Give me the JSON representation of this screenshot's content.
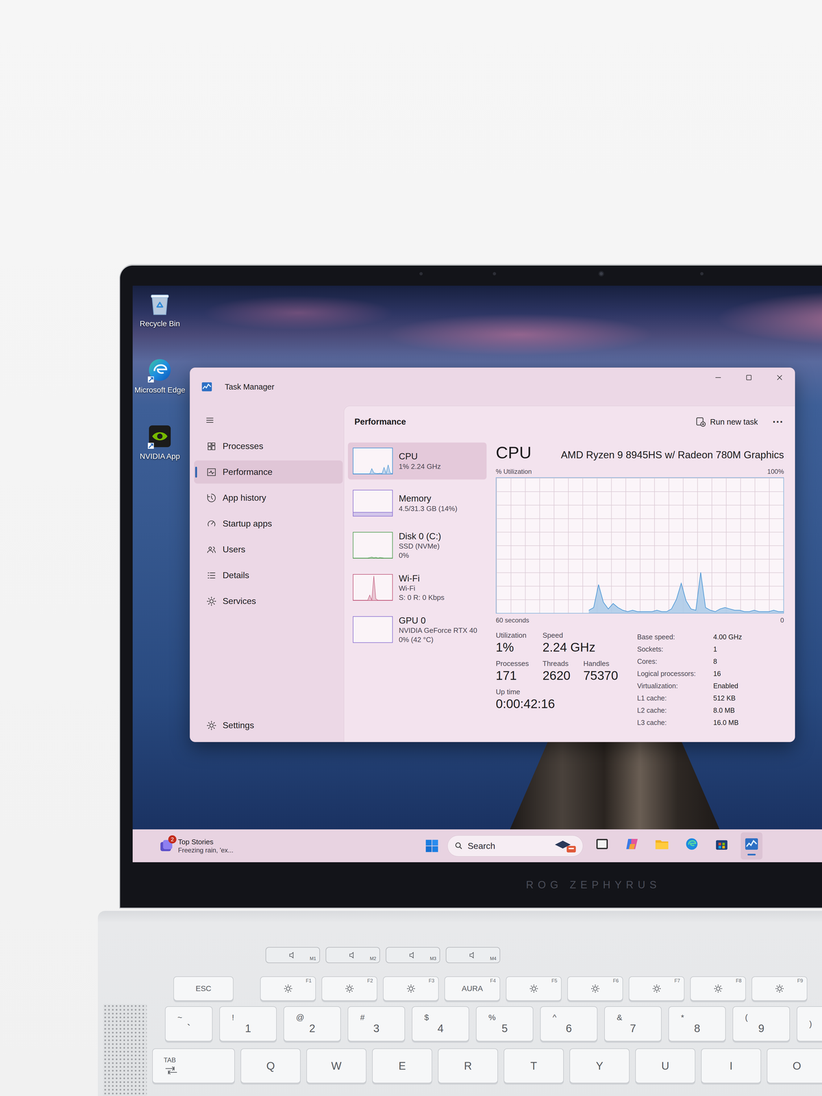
{
  "desktop_icons": [
    {
      "label": "Recycle Bin"
    },
    {
      "label": "Microsoft Edge"
    },
    {
      "label": "NVIDIA App"
    }
  ],
  "window": {
    "title": "Task Manager"
  },
  "sidebar": {
    "items": [
      {
        "label": "Processes",
        "selected": false
      },
      {
        "label": "Performance",
        "selected": true
      },
      {
        "label": "App history",
        "selected": false
      },
      {
        "label": "Startup apps",
        "selected": false
      },
      {
        "label": "Users",
        "selected": false
      },
      {
        "label": "Details",
        "selected": false
      },
      {
        "label": "Services",
        "selected": false
      }
    ],
    "settings": "Settings"
  },
  "header": {
    "title": "Performance",
    "action": "Run new task",
    "more": "···"
  },
  "resources": [
    {
      "name": "CPU",
      "lines": [
        "1% 2.24 GHz"
      ],
      "selected": true,
      "color": "#3f8fd2",
      "kind": "line",
      "values": [
        0,
        0,
        0,
        0,
        0,
        0,
        0,
        0,
        0,
        20,
        4,
        2,
        1,
        2,
        1,
        25,
        2,
        35,
        3,
        1
      ]
    },
    {
      "name": "Memory",
      "lines": [
        "4.5/31.3 GB (14%)"
      ],
      "selected": false,
      "color": "#8a6fd0",
      "kind": "fill",
      "level": 0.14
    },
    {
      "name": "Disk 0 (C:)",
      "lines": [
        "SSD (NVMe)",
        "0%"
      ],
      "selected": false,
      "color": "#4d9a4d",
      "kind": "line",
      "values": [
        0,
        0,
        0,
        0,
        0,
        0,
        0,
        0,
        2,
        4,
        1,
        3,
        0,
        2,
        1,
        0,
        0,
        0,
        0,
        0
      ]
    },
    {
      "name": "Wi-Fi",
      "lines": [
        "Wi-Fi",
        "S: 0 R: 0 Kbps"
      ],
      "selected": false,
      "color": "#c0587a",
      "kind": "line",
      "values": [
        0,
        0,
        0,
        0,
        0,
        0,
        0,
        0,
        20,
        0,
        95,
        5,
        0,
        0,
        0,
        0,
        0,
        0,
        0,
        0
      ]
    },
    {
      "name": "GPU 0",
      "lines": [
        "NVIDIA GeForce RTX 40",
        "0% (42 °C)"
      ],
      "selected": false,
      "color": "#8a6fd0",
      "kind": "line",
      "values": []
    }
  ],
  "chart": {
    "title": "CPU",
    "model": "AMD Ryzen 9 8945HS w/ Radeon 780M Graphics",
    "y_label": "% Utilization",
    "y_max": "100%",
    "x_left": "60 seconds",
    "x_right": "0",
    "y_max_value": 100,
    "window_seconds": 60,
    "values": [
      2,
      4,
      21,
      8,
      3,
      7,
      4,
      2,
      1,
      2,
      1,
      1,
      1,
      1,
      2,
      1,
      1,
      3,
      10,
      22,
      9,
      3,
      2,
      30,
      4,
      2,
      1,
      3,
      4,
      3,
      2,
      2,
      1,
      1,
      2,
      1,
      1,
      1,
      2,
      1,
      1
    ]
  },
  "stat_rows": [
    [
      {
        "label": "Utilization",
        "value": "1%"
      },
      {
        "label": "Speed",
        "value": "2.24 GHz"
      }
    ],
    [
      {
        "label": "Processes",
        "value": "171"
      },
      {
        "label": "Threads",
        "value": "2620"
      },
      {
        "label": "Handles",
        "value": "75370"
      }
    ],
    [
      {
        "label": "Up time",
        "value": "0:00:42:16"
      }
    ]
  ],
  "specs": [
    {
      "label": "Base speed:",
      "value": "4.00 GHz"
    },
    {
      "label": "Sockets:",
      "value": "1"
    },
    {
      "label": "Cores:",
      "value": "8"
    },
    {
      "label": "Logical processors:",
      "value": "16"
    },
    {
      "label": "Virtualization:",
      "value": "Enabled"
    },
    {
      "label": "L1 cache:",
      "value": "512 KB"
    },
    {
      "label": "L2 cache:",
      "value": "8.0 MB"
    },
    {
      "label": "L3 cache:",
      "value": "16.0 MB"
    }
  ],
  "taskbar": {
    "news": {
      "badge": "2",
      "title": "Top Stories",
      "text": "Freezing rain, 'ex..."
    },
    "search": "Search",
    "apps": [
      {
        "active": false
      },
      {
        "active": false
      },
      {
        "active": false
      },
      {
        "active": false
      },
      {
        "active": false
      },
      {
        "active": true
      }
    ]
  },
  "bezel_brand": "ROG ZEPHYRUS",
  "keyboard": {
    "macro_keys": [
      {
        "label": "M1"
      },
      {
        "label": "M2"
      },
      {
        "label": "M3"
      },
      {
        "label": "M4"
      }
    ],
    "rows": [
      [
        {
          "kind": "text",
          "label": "ESC"
        },
        {
          "kind": "icon",
          "fn": "F1"
        },
        {
          "kind": "icon",
          "fn": "F2"
        },
        {
          "kind": "icon",
          "fn": "F3"
        },
        {
          "kind": "text",
          "fn": "F4",
          "label": "AURA"
        },
        {
          "kind": "icon",
          "fn": "F5"
        },
        {
          "kind": "icon",
          "fn": "F6"
        },
        {
          "kind": "icon",
          "fn": "F7"
        },
        {
          "kind": "icon",
          "fn": "F8"
        },
        {
          "kind": "icon",
          "fn": "F9"
        }
      ],
      [
        {
          "kind": "dual",
          "top": "~",
          "label": "`"
        },
        {
          "kind": "dual",
          "top": "!",
          "label": "1"
        },
        {
          "kind": "dual",
          "top": "@",
          "label": "2"
        },
        {
          "kind": "dual",
          "top": "#",
          "label": "3"
        },
        {
          "kind": "dual",
          "top": "$",
          "label": "4"
        },
        {
          "kind": "dual",
          "top": "%",
          "label": "5"
        },
        {
          "kind": "dual",
          "top": "^",
          "label": "6"
        },
        {
          "kind": "dual",
          "top": "&",
          "label": "7"
        },
        {
          "kind": "dual",
          "top": "*",
          "label": "8"
        },
        {
          "kind": "dual",
          "top": "(",
          "label": "9"
        },
        {
          "kind": "dual",
          "top": ")"
        }
      ],
      [
        {
          "kind": "tab",
          "label": "TAB"
        },
        {
          "kind": "text",
          "label": "Q"
        },
        {
          "kind": "text",
          "label": "W"
        },
        {
          "kind": "text",
          "label": "E"
        },
        {
          "kind": "text",
          "label": "R"
        },
        {
          "kind": "text",
          "label": "T"
        },
        {
          "kind": "text",
          "label": "Y"
        },
        {
          "kind": "text",
          "label": "U"
        },
        {
          "kind": "text",
          "label": "I"
        },
        {
          "kind": "text",
          "label": "O"
        }
      ]
    ]
  }
}
